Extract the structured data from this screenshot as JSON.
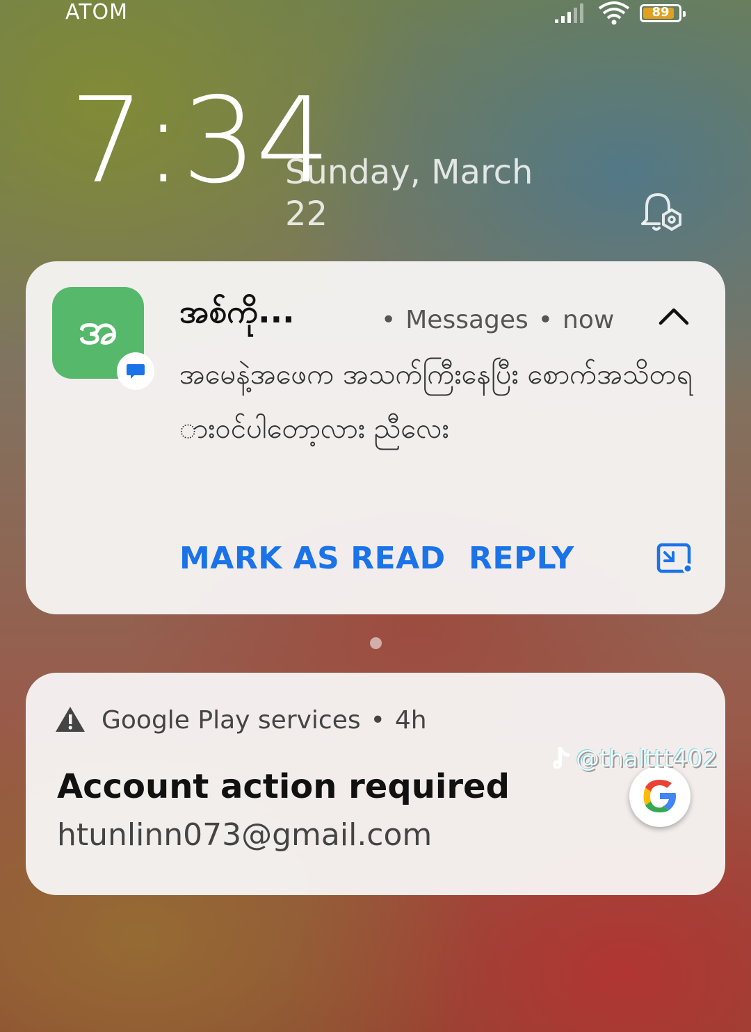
{
  "status_bar": {
    "carrier": "ATOM",
    "battery": "89",
    "battery_level": 0.89,
    "icons": [
      "signal-icon",
      "wifi-icon",
      "battery-icon"
    ]
  },
  "lockscreen": {
    "time": "7:34",
    "date_line1": "Sunday, March",
    "date_line2": "22"
  },
  "notification_messages": {
    "app_icon_text": "အ",
    "sender": "အစ်ကို...",
    "app_name": "Messages",
    "time": "now",
    "message": "အမေနဲ့အဖေက အသက်ကြီးနေပြီး စောက်အသိတရားဝင်ပါတော့လား ညီလေး",
    "actions": {
      "mark_as_read": "MARK AS READ",
      "reply": "REPLY"
    },
    "accent_color": "#1a73e8",
    "icon_color": "#56b86a"
  },
  "notification_google": {
    "app_name": "Google Play services",
    "time": "4h",
    "title": "Account action required",
    "account": "htunlinn073@gmail.com"
  },
  "watermark": {
    "handle": "@thalttt402"
  }
}
